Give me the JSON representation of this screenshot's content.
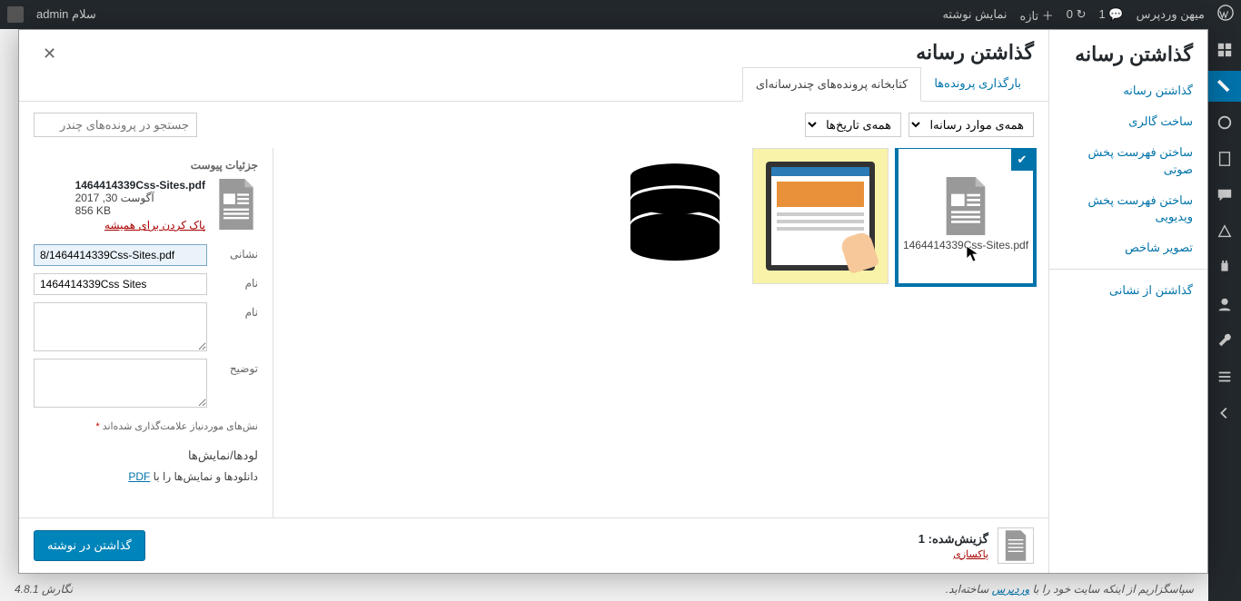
{
  "adminbar": {
    "wp": "میهن وردپرس",
    "comments": "1",
    "updates": "0",
    "new": "تازه",
    "view": "نمایش نوشته",
    "greeting": "سلام",
    "user": "admin"
  },
  "modal": {
    "title": "گذاشتن رسانه",
    "sidebar": {
      "items": [
        "گذاشتن رسانه",
        "ساخت گالری",
        "ساختن فهرست پخش صوتی",
        "ساختن فهرست پخش ویدیویی",
        "تصویر شاخص"
      ],
      "url_item": "گذاشتن از نشانی"
    },
    "tabs": {
      "upload": "بارگذاری پرونده‌ها",
      "library": "کتابخانه پرونده‌های چندرسانه‌ای"
    },
    "filters": {
      "type": "همه‌ی موارد رسانه‌ا",
      "date": "همه‌ی تاریخ‌ها",
      "search_placeholder": "جستجو در پرونده‌های چندر"
    },
    "attachments": [
      {
        "name": "1464414339Css-Sites.pdf",
        "type": "document",
        "selected": true
      },
      {
        "name": "tablet",
        "type": "image-tablet",
        "selected": false
      },
      {
        "name": "database",
        "type": "image-db",
        "selected": false
      }
    ],
    "details": {
      "heading": "جزئیات پیوست",
      "filename": "1464414339Css-Sites.pdf",
      "date": "آگوست 30, 2017",
      "size": "856 KB",
      "delete": "پاک کردن برای همیشه",
      "fields": {
        "url_label": "نشانی",
        "url_value": "8/1464414339Css-Sites.pdf",
        "title_label": "نام",
        "title_value": "1464414339Css Sites",
        "caption_label": "نام",
        "desc_label": "توضیح"
      },
      "required_note": "نش‌های موردنیاز علامت‌گذاری شده‌اند",
      "downloads_title": "لودها/نمایش‌ها",
      "downloads_text_prefix": "دانلودها و نمایش‌ها را با ",
      "downloads_link": "PDF"
    },
    "footer": {
      "selected_label": "گزینش‌شده:",
      "selected_count": "1",
      "clear": "پاکسازی",
      "insert": "گذاشتن در نوشته"
    }
  },
  "page_footer": {
    "thanks_prefix": "سپاسگزاریم از اینکه سایت خود را با ",
    "wp_link": "وردپرس",
    "thanks_suffix": " ساخته‌اید.",
    "version": "نگارش 4.8.1"
  }
}
